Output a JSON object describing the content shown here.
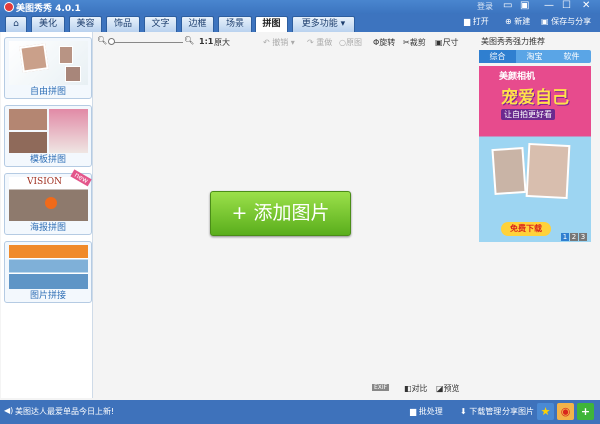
{
  "window": {
    "title": "美图秀秀 4.0.1",
    "login": "登录",
    "controls": [
      "▭",
      "▣",
      "—",
      "☐",
      "✕"
    ]
  },
  "tabs": [
    {
      "label": "⌂",
      "icon": "home-icon"
    },
    {
      "label": "美化"
    },
    {
      "label": "美容"
    },
    {
      "label": "饰品"
    },
    {
      "label": "文字"
    },
    {
      "label": "边框"
    },
    {
      "label": "场景"
    },
    {
      "label": "拼图",
      "active": true
    },
    {
      "label": "更多功能 ▾"
    }
  ],
  "toprightactions": {
    "open": "打开",
    "new": "新建",
    "save": "保存与分享"
  },
  "leftpanel": {
    "items": [
      {
        "label": "自由拼图"
      },
      {
        "label": "模板拼图"
      },
      {
        "label": "海报拼图",
        "badge": "new",
        "poster_text": "VISION"
      },
      {
        "label": "图片拼接"
      }
    ]
  },
  "toolbar": {
    "zoom_ratio": "1:1",
    "original": "原大",
    "undo": "撤销",
    "redo": "重做",
    "reset": "原图",
    "rotate": "旋转",
    "crop": "裁剪",
    "size": "尺寸"
  },
  "canvas": {
    "add_button": "+ 添加图片"
  },
  "rightpanel": {
    "title": "美图秀秀强力推荐",
    "tabs": [
      "综合",
      "淘宝",
      "软件"
    ],
    "active_tab": 0,
    "ad": {
      "brand": "美颜相机",
      "headline": "宠爱自己",
      "tagline": "让自拍更好看",
      "cta": "免费下载",
      "pages": [
        "1",
        "2",
        "3"
      ]
    }
  },
  "bottomtools": {
    "exif": "EXIF",
    "compare": "对比",
    "preview": "预览"
  },
  "statusbar": {
    "message": "美图达人最爱单品今日上新!",
    "batch": "批处理",
    "download": "下载管理",
    "share": "分享图片"
  },
  "colors": {
    "titlebar": "#3c74bf",
    "add_button": "#6cbf25",
    "accent": "#2f6fb6"
  }
}
